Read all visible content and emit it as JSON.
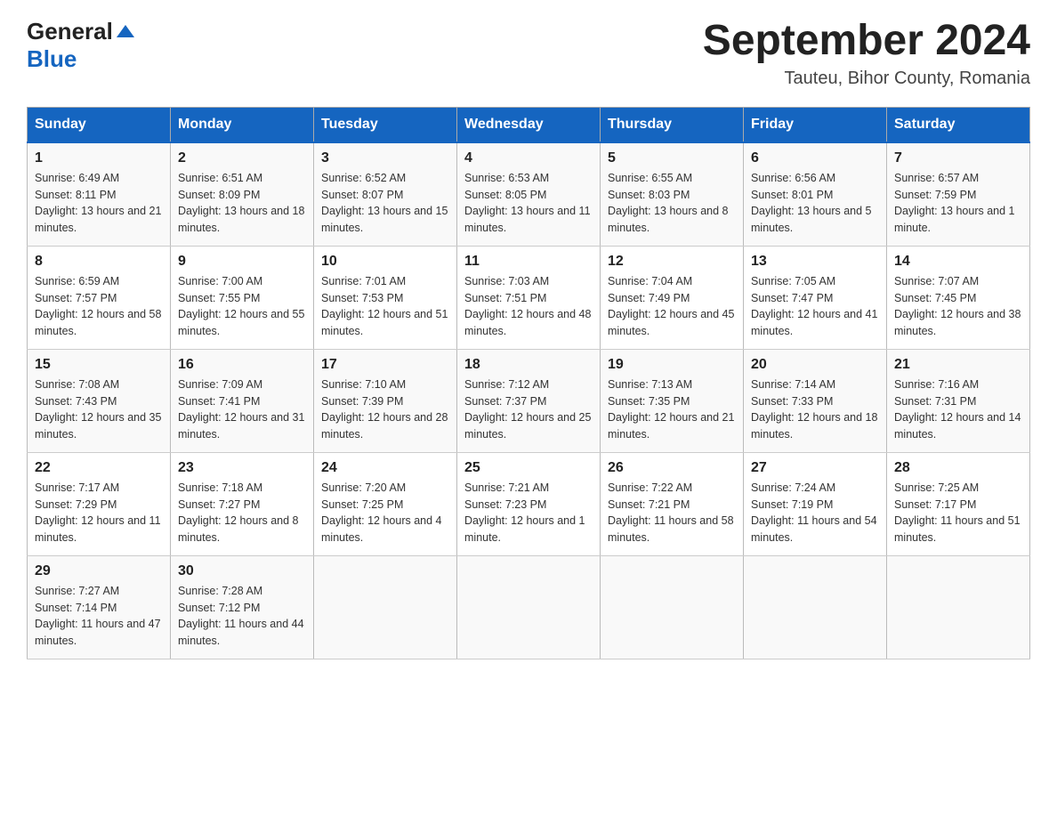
{
  "header": {
    "logo_general": "General",
    "logo_blue": "Blue",
    "month_year": "September 2024",
    "location": "Tauteu, Bihor County, Romania"
  },
  "weekdays": [
    "Sunday",
    "Monday",
    "Tuesday",
    "Wednesday",
    "Thursday",
    "Friday",
    "Saturday"
  ],
  "weeks": [
    [
      {
        "day": "1",
        "sunrise": "Sunrise: 6:49 AM",
        "sunset": "Sunset: 8:11 PM",
        "daylight": "Daylight: 13 hours and 21 minutes."
      },
      {
        "day": "2",
        "sunrise": "Sunrise: 6:51 AM",
        "sunset": "Sunset: 8:09 PM",
        "daylight": "Daylight: 13 hours and 18 minutes."
      },
      {
        "day": "3",
        "sunrise": "Sunrise: 6:52 AM",
        "sunset": "Sunset: 8:07 PM",
        "daylight": "Daylight: 13 hours and 15 minutes."
      },
      {
        "day": "4",
        "sunrise": "Sunrise: 6:53 AM",
        "sunset": "Sunset: 8:05 PM",
        "daylight": "Daylight: 13 hours and 11 minutes."
      },
      {
        "day": "5",
        "sunrise": "Sunrise: 6:55 AM",
        "sunset": "Sunset: 8:03 PM",
        "daylight": "Daylight: 13 hours and 8 minutes."
      },
      {
        "day": "6",
        "sunrise": "Sunrise: 6:56 AM",
        "sunset": "Sunset: 8:01 PM",
        "daylight": "Daylight: 13 hours and 5 minutes."
      },
      {
        "day": "7",
        "sunrise": "Sunrise: 6:57 AM",
        "sunset": "Sunset: 7:59 PM",
        "daylight": "Daylight: 13 hours and 1 minute."
      }
    ],
    [
      {
        "day": "8",
        "sunrise": "Sunrise: 6:59 AM",
        "sunset": "Sunset: 7:57 PM",
        "daylight": "Daylight: 12 hours and 58 minutes."
      },
      {
        "day": "9",
        "sunrise": "Sunrise: 7:00 AM",
        "sunset": "Sunset: 7:55 PM",
        "daylight": "Daylight: 12 hours and 55 minutes."
      },
      {
        "day": "10",
        "sunrise": "Sunrise: 7:01 AM",
        "sunset": "Sunset: 7:53 PM",
        "daylight": "Daylight: 12 hours and 51 minutes."
      },
      {
        "day": "11",
        "sunrise": "Sunrise: 7:03 AM",
        "sunset": "Sunset: 7:51 PM",
        "daylight": "Daylight: 12 hours and 48 minutes."
      },
      {
        "day": "12",
        "sunrise": "Sunrise: 7:04 AM",
        "sunset": "Sunset: 7:49 PM",
        "daylight": "Daylight: 12 hours and 45 minutes."
      },
      {
        "day": "13",
        "sunrise": "Sunrise: 7:05 AM",
        "sunset": "Sunset: 7:47 PM",
        "daylight": "Daylight: 12 hours and 41 minutes."
      },
      {
        "day": "14",
        "sunrise": "Sunrise: 7:07 AM",
        "sunset": "Sunset: 7:45 PM",
        "daylight": "Daylight: 12 hours and 38 minutes."
      }
    ],
    [
      {
        "day": "15",
        "sunrise": "Sunrise: 7:08 AM",
        "sunset": "Sunset: 7:43 PM",
        "daylight": "Daylight: 12 hours and 35 minutes."
      },
      {
        "day": "16",
        "sunrise": "Sunrise: 7:09 AM",
        "sunset": "Sunset: 7:41 PM",
        "daylight": "Daylight: 12 hours and 31 minutes."
      },
      {
        "day": "17",
        "sunrise": "Sunrise: 7:10 AM",
        "sunset": "Sunset: 7:39 PM",
        "daylight": "Daylight: 12 hours and 28 minutes."
      },
      {
        "day": "18",
        "sunrise": "Sunrise: 7:12 AM",
        "sunset": "Sunset: 7:37 PM",
        "daylight": "Daylight: 12 hours and 25 minutes."
      },
      {
        "day": "19",
        "sunrise": "Sunrise: 7:13 AM",
        "sunset": "Sunset: 7:35 PM",
        "daylight": "Daylight: 12 hours and 21 minutes."
      },
      {
        "day": "20",
        "sunrise": "Sunrise: 7:14 AM",
        "sunset": "Sunset: 7:33 PM",
        "daylight": "Daylight: 12 hours and 18 minutes."
      },
      {
        "day": "21",
        "sunrise": "Sunrise: 7:16 AM",
        "sunset": "Sunset: 7:31 PM",
        "daylight": "Daylight: 12 hours and 14 minutes."
      }
    ],
    [
      {
        "day": "22",
        "sunrise": "Sunrise: 7:17 AM",
        "sunset": "Sunset: 7:29 PM",
        "daylight": "Daylight: 12 hours and 11 minutes."
      },
      {
        "day": "23",
        "sunrise": "Sunrise: 7:18 AM",
        "sunset": "Sunset: 7:27 PM",
        "daylight": "Daylight: 12 hours and 8 minutes."
      },
      {
        "day": "24",
        "sunrise": "Sunrise: 7:20 AM",
        "sunset": "Sunset: 7:25 PM",
        "daylight": "Daylight: 12 hours and 4 minutes."
      },
      {
        "day": "25",
        "sunrise": "Sunrise: 7:21 AM",
        "sunset": "Sunset: 7:23 PM",
        "daylight": "Daylight: 12 hours and 1 minute."
      },
      {
        "day": "26",
        "sunrise": "Sunrise: 7:22 AM",
        "sunset": "Sunset: 7:21 PM",
        "daylight": "Daylight: 11 hours and 58 minutes."
      },
      {
        "day": "27",
        "sunrise": "Sunrise: 7:24 AM",
        "sunset": "Sunset: 7:19 PM",
        "daylight": "Daylight: 11 hours and 54 minutes."
      },
      {
        "day": "28",
        "sunrise": "Sunrise: 7:25 AM",
        "sunset": "Sunset: 7:17 PM",
        "daylight": "Daylight: 11 hours and 51 minutes."
      }
    ],
    [
      {
        "day": "29",
        "sunrise": "Sunrise: 7:27 AM",
        "sunset": "Sunset: 7:14 PM",
        "daylight": "Daylight: 11 hours and 47 minutes."
      },
      {
        "day": "30",
        "sunrise": "Sunrise: 7:28 AM",
        "sunset": "Sunset: 7:12 PM",
        "daylight": "Daylight: 11 hours and 44 minutes."
      },
      null,
      null,
      null,
      null,
      null
    ]
  ]
}
